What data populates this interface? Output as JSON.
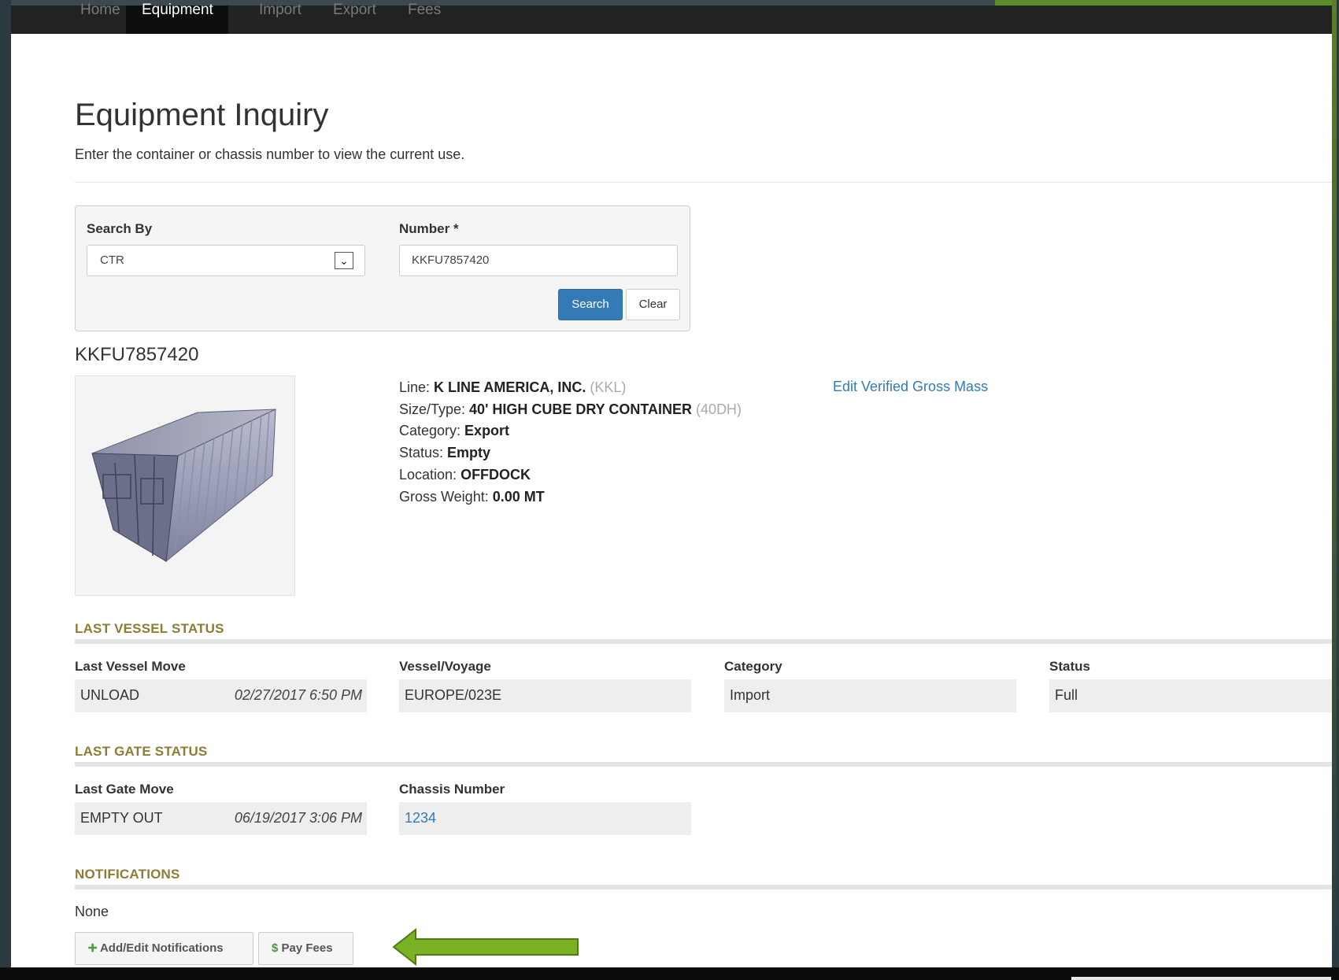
{
  "nav": {
    "items": [
      {
        "label": "Home"
      },
      {
        "label": "Equipment"
      },
      {
        "label": "Import"
      },
      {
        "label": "Export"
      },
      {
        "label": "Fees"
      }
    ]
  },
  "page": {
    "title": "Equipment Inquiry",
    "subtitle": "Enter the container or chassis number to view the current use."
  },
  "search": {
    "search_by_label": "Search By",
    "search_by_value": "CTR",
    "number_label": "Number *",
    "number_value": "KKFU7857420",
    "search_button": "Search",
    "clear_button": "Clear"
  },
  "container": {
    "number": "KKFU7857420",
    "line_label": "Line: ",
    "line_value": "K LINE AMERICA, INC.",
    "line_code": "(KKL)",
    "size_label": "Size/Type: ",
    "size_value": "40' HIGH CUBE DRY CONTAINER",
    "size_code": "(40DH)",
    "category_label": "Category: ",
    "category_value": "Export",
    "status_label": "Status: ",
    "status_value": "Empty",
    "location_label": "Location: ",
    "location_value": "OFFDOCK",
    "weight_label": "Gross Weight: ",
    "weight_value": "0.00 MT",
    "vgm_link": "Edit Verified Gross Mass"
  },
  "vessel_status": {
    "heading": "LAST VESSEL STATUS",
    "move_label": "Last Vessel Move",
    "move_value": "UNLOAD",
    "move_date": "02/27/2017 6:50 PM",
    "voyage_label": "Vessel/Voyage",
    "voyage_value": "EUROPE/023E",
    "category_label": "Category",
    "category_value": "Import",
    "status_label": "Status",
    "status_value": "Full"
  },
  "gate_status": {
    "heading": "LAST GATE STATUS",
    "move_label": "Last Gate Move",
    "move_value": "EMPTY OUT",
    "move_date": "06/19/2017 3:06 PM",
    "chassis_label": "Chassis Number",
    "chassis_value": "1234"
  },
  "notifications": {
    "heading": "NOTIFICATIONS",
    "value": "None",
    "add_edit_button": "Add/Edit Notifications",
    "pay_fees_button": "Pay Fees"
  },
  "colors": {
    "accent": "#337ab7",
    "section_heading": "#8c7d35",
    "arrow": "#7ab226"
  },
  "icons": {
    "add_icon": "plus-circle-icon",
    "dollar_icon": "dollar-icon",
    "dropdown_icon": "chevron-down-icon",
    "callout_arrow": "left-arrow-icon"
  }
}
